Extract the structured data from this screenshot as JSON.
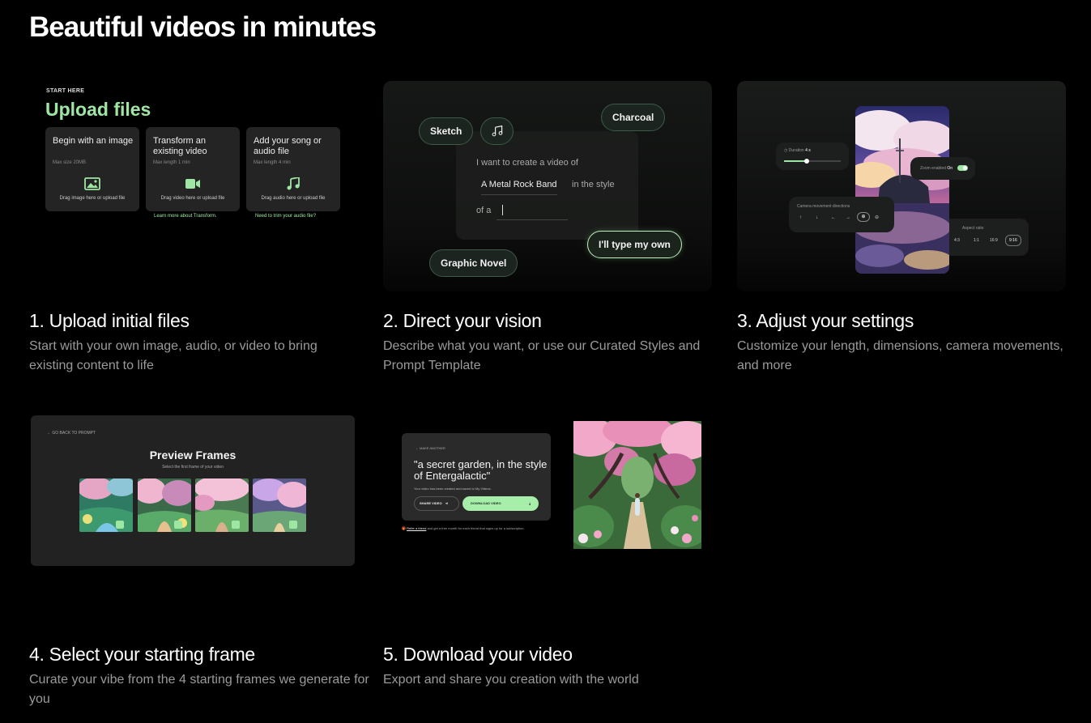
{
  "page": {
    "title": "Beautiful videos in minutes"
  },
  "colors": {
    "accent_green": "#9ee6a3",
    "background": "#000000",
    "muted_text": "#9a9a9a"
  },
  "steps": [
    {
      "title": "1. Upload initial files",
      "description": "Start with your own image, audio, or video to bring existing content to life"
    },
    {
      "title": "2. Direct your vision",
      "description": "Describe what you want, or use our Curated Styles and Prompt Template"
    },
    {
      "title": "3. Adjust your settings",
      "description": "Customize your length, dimensions, camera movements, and more"
    },
    {
      "title": "4. Select your starting frame",
      "description": "Curate your vibe from the 4 starting frames we generate for you"
    },
    {
      "title": "5. Download your video",
      "description": "Export and share you creation with the world"
    }
  ],
  "upload_card": {
    "eyebrow": "START HERE",
    "heading": "Upload files",
    "boxes": [
      {
        "title": "Begin with an image",
        "meta": "Max size 20MB",
        "icon": "image-icon",
        "drop": "Drag image here or upload file"
      },
      {
        "title": "Transform an existing video",
        "meta": "Max length 1 min",
        "icon": "video-camera-icon",
        "drop": "Drag video here or upload file"
      },
      {
        "title": "Add your song or audio file",
        "meta": "Max length 4 min",
        "icon": "music-note-icon",
        "drop": "Drag audio here or upload file"
      }
    ],
    "learn_link": "Learn more about Transform.",
    "trim_link": "Need to trim your audio file?"
  },
  "vision_card": {
    "styles": {
      "sketch": "Sketch",
      "charcoal": "Charcoal",
      "graphic_novel": "Graphic Novel",
      "own": "I'll type my own"
    },
    "music_icon": "music-note-icon",
    "prompt_line1": "I want to create a video of",
    "prompt_subject": "A Metal Rock Band",
    "prompt_style": "in the style",
    "prompt_of": "of a"
  },
  "settings_card": {
    "duration_label": "Duration",
    "duration_value": "4 s",
    "duration_level": 0.4,
    "zoom_label": "Zoom enabled",
    "zoom_value": "On",
    "camera_label": "Camera movement directions",
    "camera_icons": [
      "arrow-up-icon",
      "arrow-down-icon",
      "arrow-left-icon",
      "arrow-right-icon",
      "zoom-in-icon",
      "zoom-out-icon"
    ],
    "aspect_label": "Aspect ratio",
    "aspect_options": [
      "4:3",
      "1:1",
      "16:9",
      "9:16"
    ],
    "aspect_selected": "9:16"
  },
  "frames_card": {
    "back": "GO BACK TO PROMPT",
    "heading": "Preview Frames",
    "sub": "Select the first frame of your video"
  },
  "download_card": {
    "back": "MAKE ANOTHER",
    "quote": "\"a secret garden, in the style of Entergalactic\"",
    "saved": "Your video has been created and saved to My Videos.",
    "share": "SHARE VIDEO",
    "download": "DOWNLOAD VIDEO",
    "refer_link": "Refer a friend",
    "refer_text": " and get a free month for each friend that signs up for a subscription."
  }
}
